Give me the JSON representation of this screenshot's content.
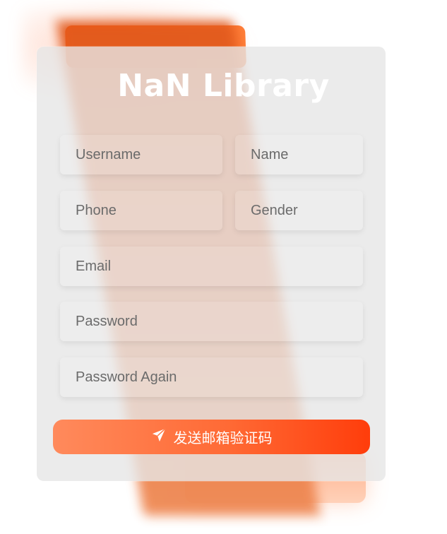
{
  "title": "NaN Library",
  "fields": {
    "username": {
      "placeholder": "Username"
    },
    "name": {
      "placeholder": "Name"
    },
    "phone": {
      "placeholder": "Phone"
    },
    "gender": {
      "placeholder": "Gender"
    },
    "email": {
      "placeholder": "Email"
    },
    "password": {
      "placeholder": "Password"
    },
    "password_again": {
      "placeholder": "Password Again"
    }
  },
  "send_button": {
    "label": "发送邮箱验证码",
    "icon": "paper-plane-icon"
  },
  "colors": {
    "accent": "#ff5a10",
    "button_start": "#ff8a5c",
    "button_end": "#ff3d0b"
  }
}
